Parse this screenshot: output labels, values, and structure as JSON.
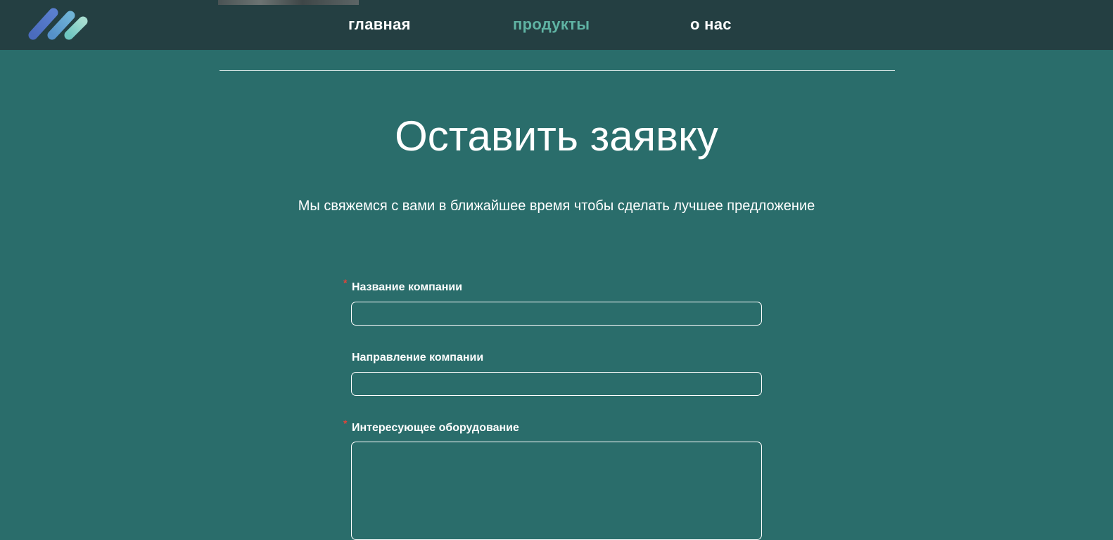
{
  "nav": {
    "home": "главная",
    "products": "продукты",
    "about": "о нас"
  },
  "colors": {
    "header_bg": "#243f42",
    "page_bg": "#2a6d6b",
    "nav_active": "#5fb3a3",
    "required_star": "#e0443a"
  },
  "hero": {
    "title": "Оставить заявку",
    "subtitle": "Мы свяжемся с вами в ближайшее время чтобы сделать лучшее предложение"
  },
  "form": {
    "required_mark": "*",
    "company_name": {
      "label": "Название компании",
      "value": "",
      "required": true
    },
    "company_direction": {
      "label": "Направление компании",
      "value": "",
      "required": false
    },
    "equipment": {
      "label": "Интересующее оборудование",
      "value": "",
      "required": true
    }
  }
}
